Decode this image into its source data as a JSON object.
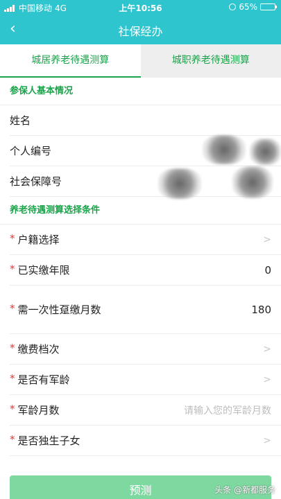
{
  "status_bar": {
    "carrier": "中国移动",
    "network": "4G",
    "time": "上午10:56",
    "battery": "65%",
    "battery_level": 0.65
  },
  "nav": {
    "back_icon": "‹",
    "title": "社保经办"
  },
  "tabs": [
    {
      "label": "城居养老待遇测算",
      "active": true
    },
    {
      "label": "城职养老待遇测算",
      "active": false
    }
  ],
  "basic": {
    "title": "参保人基本情况",
    "rows": [
      {
        "label": "姓名"
      },
      {
        "label": "个人编号"
      },
      {
        "label": "社会保障号"
      }
    ]
  },
  "conditions": {
    "title": "养老待遇测算选择条件",
    "rows": [
      {
        "label": "户籍选择",
        "arrow": ">"
      },
      {
        "label": "已实缴年限",
        "value": "0"
      },
      {
        "label": "需一次性趸缴月数",
        "value": "180"
      },
      {
        "label": "缴费档次",
        "arrow": ">"
      },
      {
        "label": "是否有军龄",
        "arrow": ">"
      },
      {
        "label": "军龄月数",
        "placeholder": "请输入您的军龄月数"
      },
      {
        "label": "是否独生子女",
        "arrow": ">"
      }
    ]
  },
  "predict_button": "预测",
  "watermark": "头条 @新都服务"
}
